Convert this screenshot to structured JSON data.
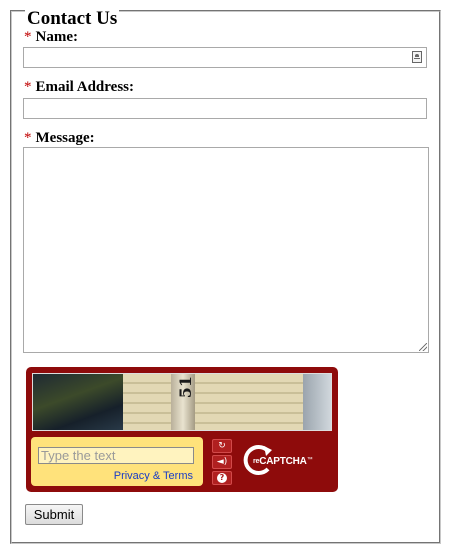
{
  "form": {
    "legend": "Contact Us",
    "required_marker": "*",
    "name_label": "Name:",
    "email_label": "Email Address:",
    "message_label": "Message:",
    "name_value": "",
    "email_value": "",
    "message_value": "",
    "submit_label": "Submit"
  },
  "captcha": {
    "image_text": "51",
    "placeholder": "Type the text",
    "privacy_link": "Privacy & Terms",
    "brand_prefix": "re",
    "brand_name": "CAPTCHA",
    "brand_tm": "™",
    "icons": [
      "refresh-icon",
      "audio-icon",
      "help-icon"
    ]
  },
  "colors": {
    "captcha_bg": "#8e0b0b",
    "captcha_panel": "#ffe27b",
    "required": "#c00000",
    "link": "#1a3cc6"
  }
}
